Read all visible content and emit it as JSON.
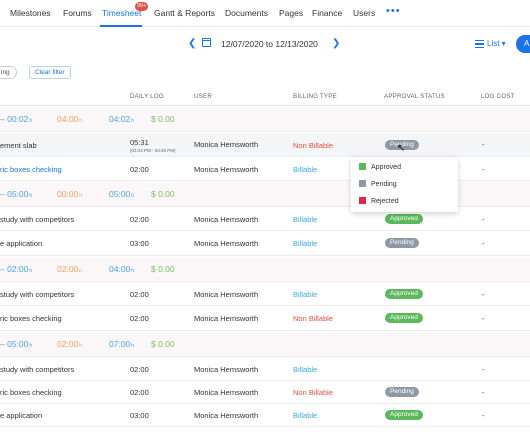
{
  "nav": {
    "items": [
      "Milestones",
      "Forums",
      "Timesheet",
      "Gantt & Reports",
      "Documents",
      "Pages",
      "Finance",
      "Users"
    ],
    "badge": "99+",
    "more": "•••"
  },
  "toolbar": {
    "date_range": "12/07/2020 to 12/13/2020",
    "view_label": "List",
    "add_label": "A"
  },
  "filter": {
    "tag_label": "ing",
    "clear_label": "Clear filter"
  },
  "columns": [
    "DAILY LOG",
    "USER",
    "BILLING TYPE",
    "APPROVAL STATUS",
    "LOG COST"
  ],
  "status_menu": {
    "options": [
      "Approved",
      "Pending",
      "Rejected"
    ]
  },
  "groups": [
    {
      "total": "00:02",
      "nonbillable": "04:00",
      "billable": "04:02",
      "cost": "$ 0.00",
      "rows": [
        {
          "task": "ement slab",
          "log": "05:31",
          "log_sub": "(03:43 PM - 03:45 PM)",
          "user": "Monica Hemsworth",
          "billing": "Non Billable",
          "status": "Pending",
          "cost": "-"
        },
        {
          "task": "ric boxes checking",
          "log": "02:00",
          "log_sub": "",
          "user": "Monica Hemsworth",
          "billing": "Billable",
          "status": "",
          "cost": "-"
        }
      ]
    },
    {
      "total": "05:00",
      "nonbillable": "00:00",
      "billable": "05:00",
      "cost": "$ 0.00",
      "rows": [
        {
          "task": "study with competitors",
          "log": "02:00",
          "log_sub": "",
          "user": "Monica Hemsworth",
          "billing": "Billable",
          "status": "Approved",
          "cost": "-"
        },
        {
          "task": "e application",
          "log": "03:00",
          "log_sub": "",
          "user": "Monica Hemsworth",
          "billing": "Billable",
          "status": "Pending",
          "cost": "-"
        }
      ]
    },
    {
      "total": "02:00",
      "nonbillable": "02:00",
      "billable": "04:00",
      "cost": "$ 0.00",
      "rows": [
        {
          "task": "study with competitors",
          "log": "02:00",
          "log_sub": "",
          "user": "Monica Hemsworth",
          "billing": "Billable",
          "status": "Approved",
          "cost": "-"
        },
        {
          "task": "ric boxes checking",
          "log": "02:00",
          "log_sub": "",
          "user": "Monica Hemsworth",
          "billing": "Non Billable",
          "status": "Approved",
          "cost": "-"
        }
      ]
    },
    {
      "total": "05:00",
      "nonbillable": "02:00",
      "billable": "07:00",
      "cost": "$ 0.00",
      "rows": [
        {
          "task": "study with competitors",
          "log": "02:00",
          "log_sub": "",
          "user": "Monica Hemsworth",
          "billing": "Billable",
          "status": "",
          "cost": "-"
        },
        {
          "task": "ric boxes checking",
          "log": "02:00",
          "log_sub": "",
          "user": "Monica Hemsworth",
          "billing": "Non Billable",
          "status": "Pending",
          "cost": "-"
        },
        {
          "task": "e application",
          "log": "03:00",
          "log_sub": "",
          "user": "Monica Hemsworth",
          "billing": "Billable",
          "status": "Approved",
          "cost": "-"
        }
      ]
    }
  ],
  "hours_unit": "h",
  "colors": {
    "accent": "#1a73e8",
    "approved": "#5cb85c",
    "pending": "#8d99a6",
    "rejected": "#e0284f",
    "billable": "#3aa8dc",
    "nonbillable": "#e05241"
  }
}
